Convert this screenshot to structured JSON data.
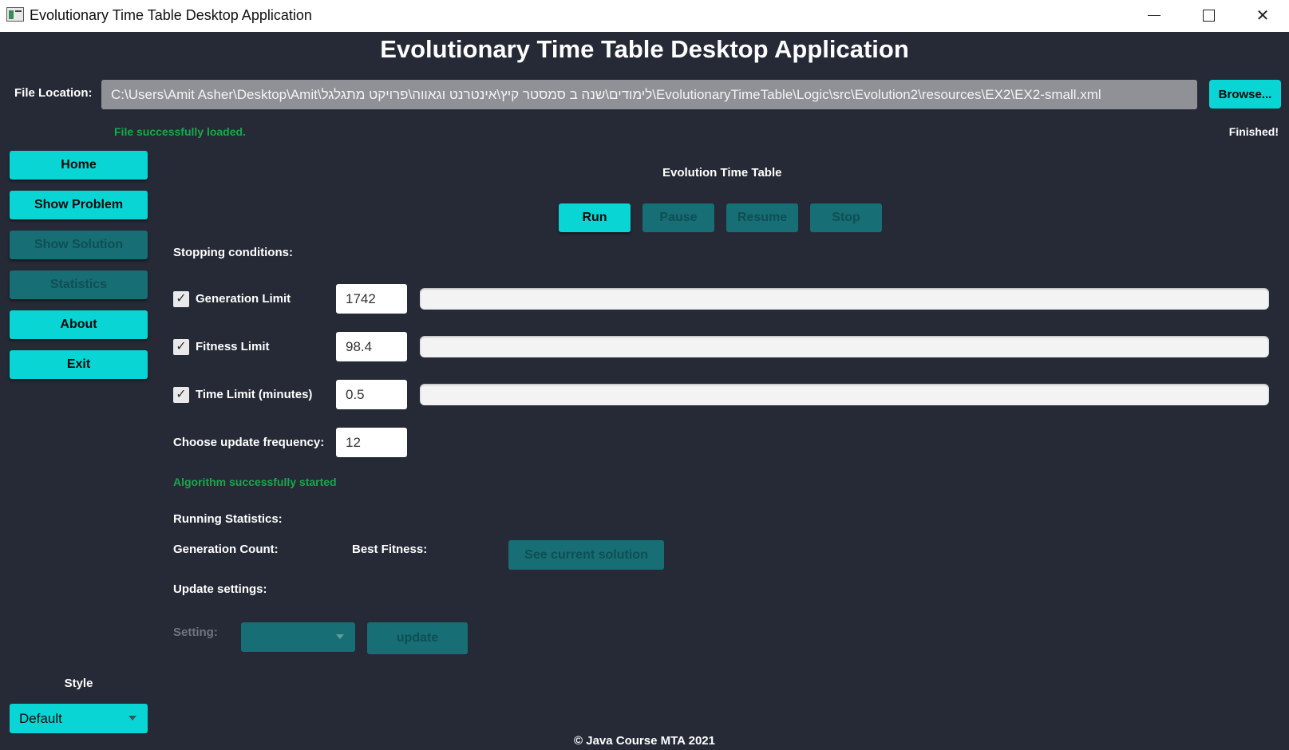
{
  "window": {
    "title": "Evolutionary Time Table Desktop Application",
    "minimize": "",
    "maximize": "",
    "close": "✕"
  },
  "header": {
    "title": "Evolutionary Time Table Desktop Application"
  },
  "file": {
    "label": "File Location:",
    "path": "C:\\Users\\Amit Asher\\Desktop\\Amit\\לימודים\\שנה ב סמסטר קיץ\\אינטרנט וגאווה\\פרויקט מתגלגל\\EvolutionaryTimeTable\\Logic\\src\\Evolution2\\resources\\EX2\\EX2-small.xml",
    "browse_label": "Browse...",
    "status": "File successfully loaded.",
    "run_status": "Finished!"
  },
  "sidebar": {
    "items": [
      {
        "label": "Home",
        "enabled": true
      },
      {
        "label": "Show Problem",
        "enabled": true
      },
      {
        "label": "Show Solution",
        "enabled": false
      },
      {
        "label": "Statistics",
        "enabled": false
      },
      {
        "label": "About",
        "enabled": true
      },
      {
        "label": "Exit",
        "enabled": true
      }
    ],
    "style_label": "Style",
    "style_value": "Default"
  },
  "main": {
    "title": "Evolution Time Table",
    "controls": {
      "run": "Run",
      "pause": "Pause",
      "resume": "Resume",
      "stop": "Stop"
    },
    "stopping_label": "Stopping conditions:",
    "conditions": [
      {
        "label": "Generation Limit",
        "value": "1742",
        "checked": true,
        "progress": 0
      },
      {
        "label": "Fitness Limit",
        "value": "98.4",
        "checked": true,
        "progress": 0
      },
      {
        "label": "Time Limit (minutes)",
        "value": "0.5",
        "checked": true,
        "progress": 0
      }
    ],
    "frequency_label": "Choose update frequency:",
    "frequency_value": "12",
    "algo_status": "Algorithm successfully started",
    "running_stats_label": "Running Statistics:",
    "generation_count_label": "Generation Count:",
    "best_fitness_label": "Best Fitness:",
    "see_solution_label": "See current solution",
    "update_settings_label": "Update settings:",
    "setting_label": "Setting:",
    "setting_value": "",
    "update_label": "update"
  },
  "footer": {
    "text": "© Java Course MTA 2021"
  },
  "colors": {
    "background": "#252a36",
    "accent": "#0ad5d5",
    "accent_disabled": "#176e74",
    "success": "#19a84a"
  }
}
